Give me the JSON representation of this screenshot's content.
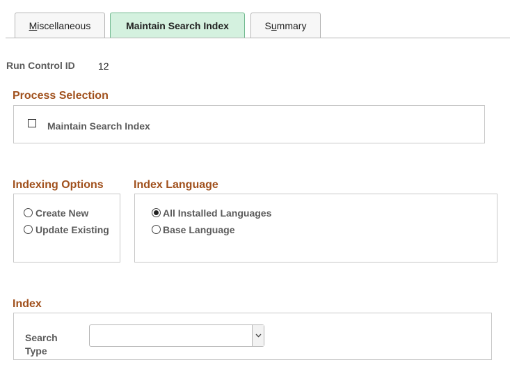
{
  "tabs": [
    {
      "label": "Miscellaneous",
      "accel": "M"
    },
    {
      "label": "Maintain Search Index"
    },
    {
      "label": "Summary",
      "accel": "u"
    }
  ],
  "run_control": {
    "label": "Run Control ID",
    "value": "12"
  },
  "process_selection": {
    "title": "Process Selection",
    "checkbox_label": "Maintain Search Index",
    "checked": false
  },
  "indexing_options": {
    "title": "Indexing Options",
    "options": [
      {
        "label": "Create New",
        "selected": false
      },
      {
        "label": "Update Existing",
        "selected": false
      }
    ]
  },
  "index_language": {
    "title": "Index Language",
    "options": [
      {
        "label": "All Installed Languages",
        "selected": true
      },
      {
        "label": "Base Language",
        "selected": false
      }
    ]
  },
  "index": {
    "title": "Index",
    "search_type_label_line1": "Search",
    "search_type_label_line2": "Type",
    "search_type_value": ""
  },
  "colors": {
    "section_title": "#a0501c",
    "active_tab_bg": "#d4f1df",
    "active_tab_border": "#6fb88e"
  }
}
